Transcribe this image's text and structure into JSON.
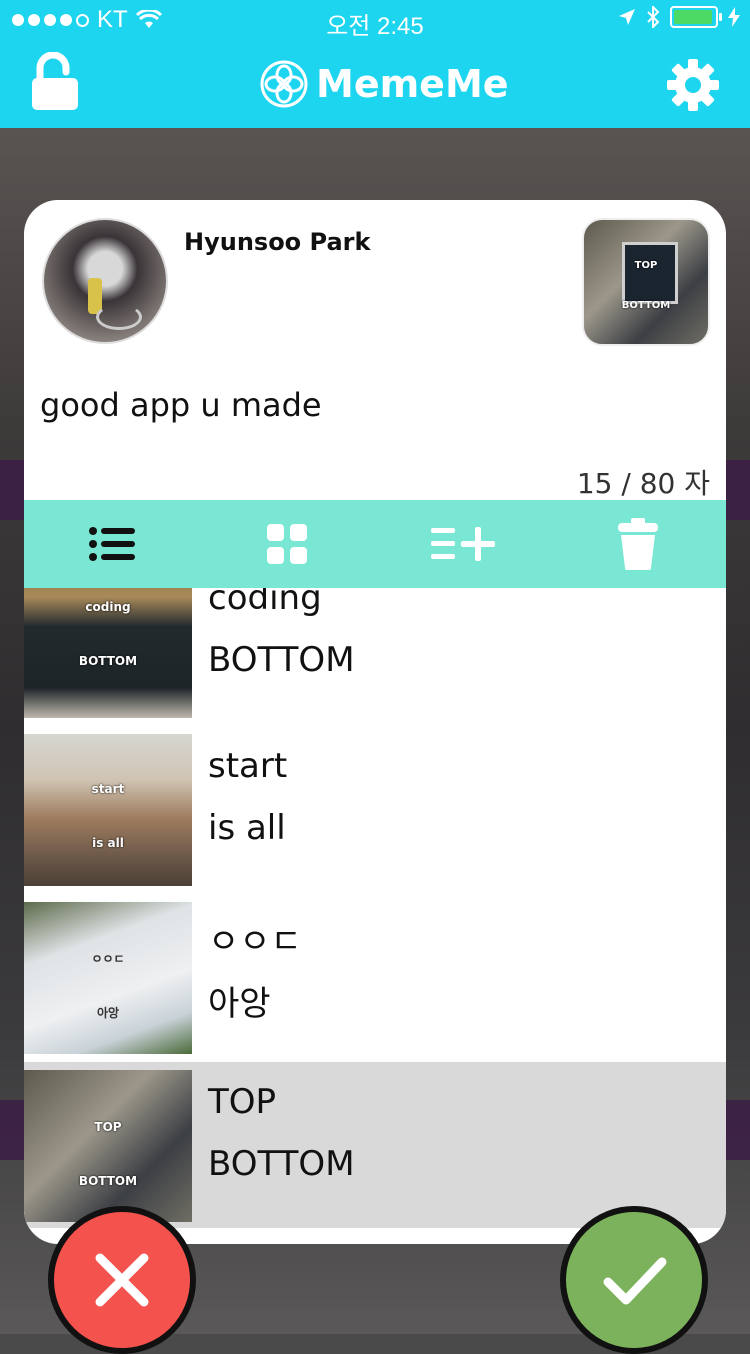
{
  "status_bar": {
    "carrier": "KT",
    "time": "오전 2:45"
  },
  "nav": {
    "title": "MemeMe",
    "left_icon": "lock-open-icon",
    "right_icon": "gear-icon"
  },
  "post": {
    "user_name": "Hyunsoo Park",
    "comment": "good app u made",
    "char_count": "15 / 80 자",
    "meme_top": "TOP",
    "meme_bottom": "BOTTOM"
  },
  "toolbar": {
    "icons": [
      "list-view-icon",
      "grid-view-icon",
      "add-to-list-icon",
      "trash-icon"
    ]
  },
  "memes": [
    {
      "top": "coding",
      "bottom": "BOTTOM",
      "thumb_top": "coding",
      "thumb_bottom": "BOTTOM"
    },
    {
      "top": "start",
      "bottom": "is all",
      "thumb_top": "start",
      "thumb_bottom": "is all"
    },
    {
      "top": "ㅇㅇㄷ",
      "bottom": "아앙",
      "thumb_top": "ㅇㅇㄷ",
      "thumb_bottom": "아앙"
    },
    {
      "top": "TOP",
      "bottom": "BOTTOM",
      "thumb_top": "TOP",
      "thumb_bottom": "BOTTOM",
      "selected": true
    }
  ],
  "actions": {
    "cancel_icon": "close-icon",
    "confirm_icon": "checkmark-icon"
  },
  "colors": {
    "brand": "#1ed5f0",
    "toolbar": "#79e7d4",
    "cancel": "#f4524d",
    "confirm": "#7cb25b",
    "selected_row": "#d9d9d9"
  }
}
